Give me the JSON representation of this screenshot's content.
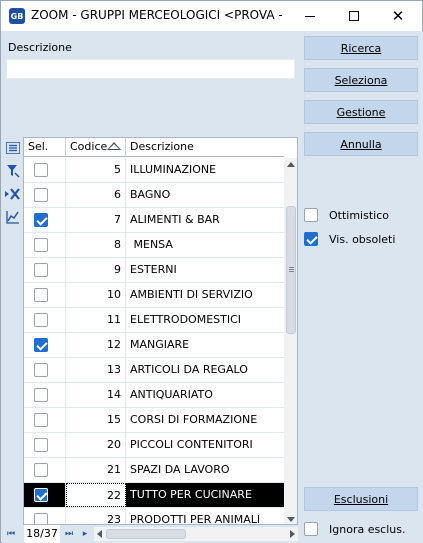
{
  "window": {
    "app_icon_text": "GB",
    "title": "ZOOM - GRUPPI MERCEOLOGICI <PROVA - B..."
  },
  "filter": {
    "description_label": "Descrizione",
    "description_value": ""
  },
  "grid": {
    "columns": {
      "sel": "Sel.",
      "code": "Codice",
      "description": "Descrizione"
    },
    "sort_column": "code",
    "sort_direction": "ascending",
    "rows": [
      {
        "checked": false,
        "code": "5",
        "description": "ILLUMINAZIONE",
        "selected": false
      },
      {
        "checked": false,
        "code": "6",
        "description": "BAGNO",
        "selected": false
      },
      {
        "checked": true,
        "code": "7",
        "description": "ALIMENTI & BAR",
        "selected": false
      },
      {
        "checked": false,
        "code": "8",
        "description": " MENSA",
        "selected": false
      },
      {
        "checked": false,
        "code": "9",
        "description": "ESTERNI",
        "selected": false
      },
      {
        "checked": false,
        "code": "10",
        "description": "AMBIENTI DI SERVIZIO",
        "selected": false
      },
      {
        "checked": false,
        "code": "11",
        "description": "ELETTRODOMESTICI",
        "selected": false
      },
      {
        "checked": true,
        "code": "12",
        "description": "MANGIARE",
        "selected": false
      },
      {
        "checked": false,
        "code": "13",
        "description": "ARTICOLI DA REGALO",
        "selected": false
      },
      {
        "checked": false,
        "code": "14",
        "description": "ANTIQUARIATO",
        "selected": false
      },
      {
        "checked": false,
        "code": "15",
        "description": "CORSI DI FORMAZIONE",
        "selected": false
      },
      {
        "checked": false,
        "code": "20",
        "description": "PICCOLI CONTENITORI",
        "selected": false
      },
      {
        "checked": false,
        "code": "21",
        "description": "SPAZI DA LAVORO",
        "selected": false
      },
      {
        "checked": true,
        "code": "22",
        "description": "TUTTO PER CUCINARE",
        "selected": true
      },
      {
        "checked": false,
        "code": "23",
        "description": "PRODOTTI PER ANIMALI",
        "selected": false
      }
    ]
  },
  "navigator": {
    "record_counter": "18/37"
  },
  "actions": {
    "ricerca": "Ricerca",
    "seleziona": "Seleziona",
    "gestione": "Gestione",
    "annulla": "Annulla",
    "esclusioni": "Esclusioni"
  },
  "options": {
    "ottimistico": {
      "label": "Ottimistico",
      "checked": false
    },
    "vis_obsoleti": {
      "label": "Vis. obsoleti",
      "checked": true
    },
    "ignora_esclus": {
      "label": "Ignora esclus.",
      "checked": false
    }
  },
  "colors": {
    "accent": "#1f6fd1",
    "panel_bg": "#dbe5ef",
    "button_bg": "#c4d6ec",
    "selected_row_bg": "#000000"
  }
}
